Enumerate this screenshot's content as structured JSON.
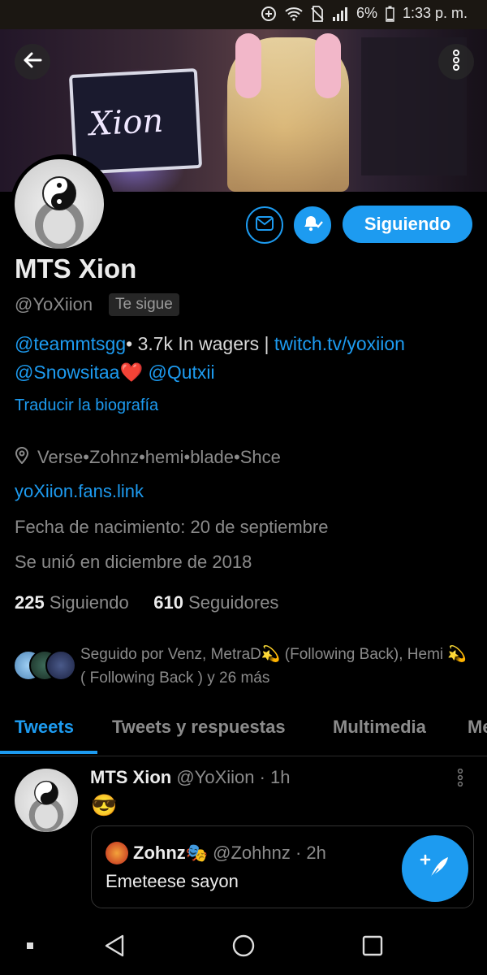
{
  "status_bar": {
    "battery": "6%",
    "time": "1:33 p. m."
  },
  "banner": {
    "tablet_text": "Xion"
  },
  "profile": {
    "name": "MTS Xion",
    "handle": "@YoXiion",
    "follows_you": "Te sigue",
    "bio_line1_link1": "@teammtsgg",
    "bio_line1_text": "• 3.7k In wagers | ",
    "bio_line1_link2": "twitch.tv/yoxiion",
    "bio_line2_link1": "@Snowsitaa",
    "bio_line2_heart": "❤️",
    "bio_line2_link2": " @Qutxii",
    "translate": "Traducir la biografía",
    "location": "Verse•Zohnz•hemi•blade•Shce",
    "website": "yoXiion.fans.link",
    "birth": "Fecha de nacimiento: 20 de septiembre",
    "joined": "Se unió en diciembre de 2018",
    "following_count": "225",
    "following_label": "Siguiendo",
    "followers_count": "610",
    "followers_label": "Seguidores",
    "followed_by": "Seguido por Venz, MetraD💫 (Following Back), Hemi 💫 ( Following Back ) y 26 más",
    "following_button": "Siguiendo"
  },
  "tabs": [
    "Tweets",
    "Tweets y respuestas",
    "Multimedia",
    "Me"
  ],
  "tweet": {
    "name": "MTS Xion",
    "handle_time": "@YoXiion · 1h",
    "emoji": "😎",
    "quote_name": "Zohnz🎭",
    "quote_handle_time": "@Zohhnz · 2h",
    "quote_text": "Emeteese sayon"
  },
  "colors": {
    "accent": "#1d9bf0",
    "background": "#000000",
    "secondary_text": "#8b8b8b"
  }
}
